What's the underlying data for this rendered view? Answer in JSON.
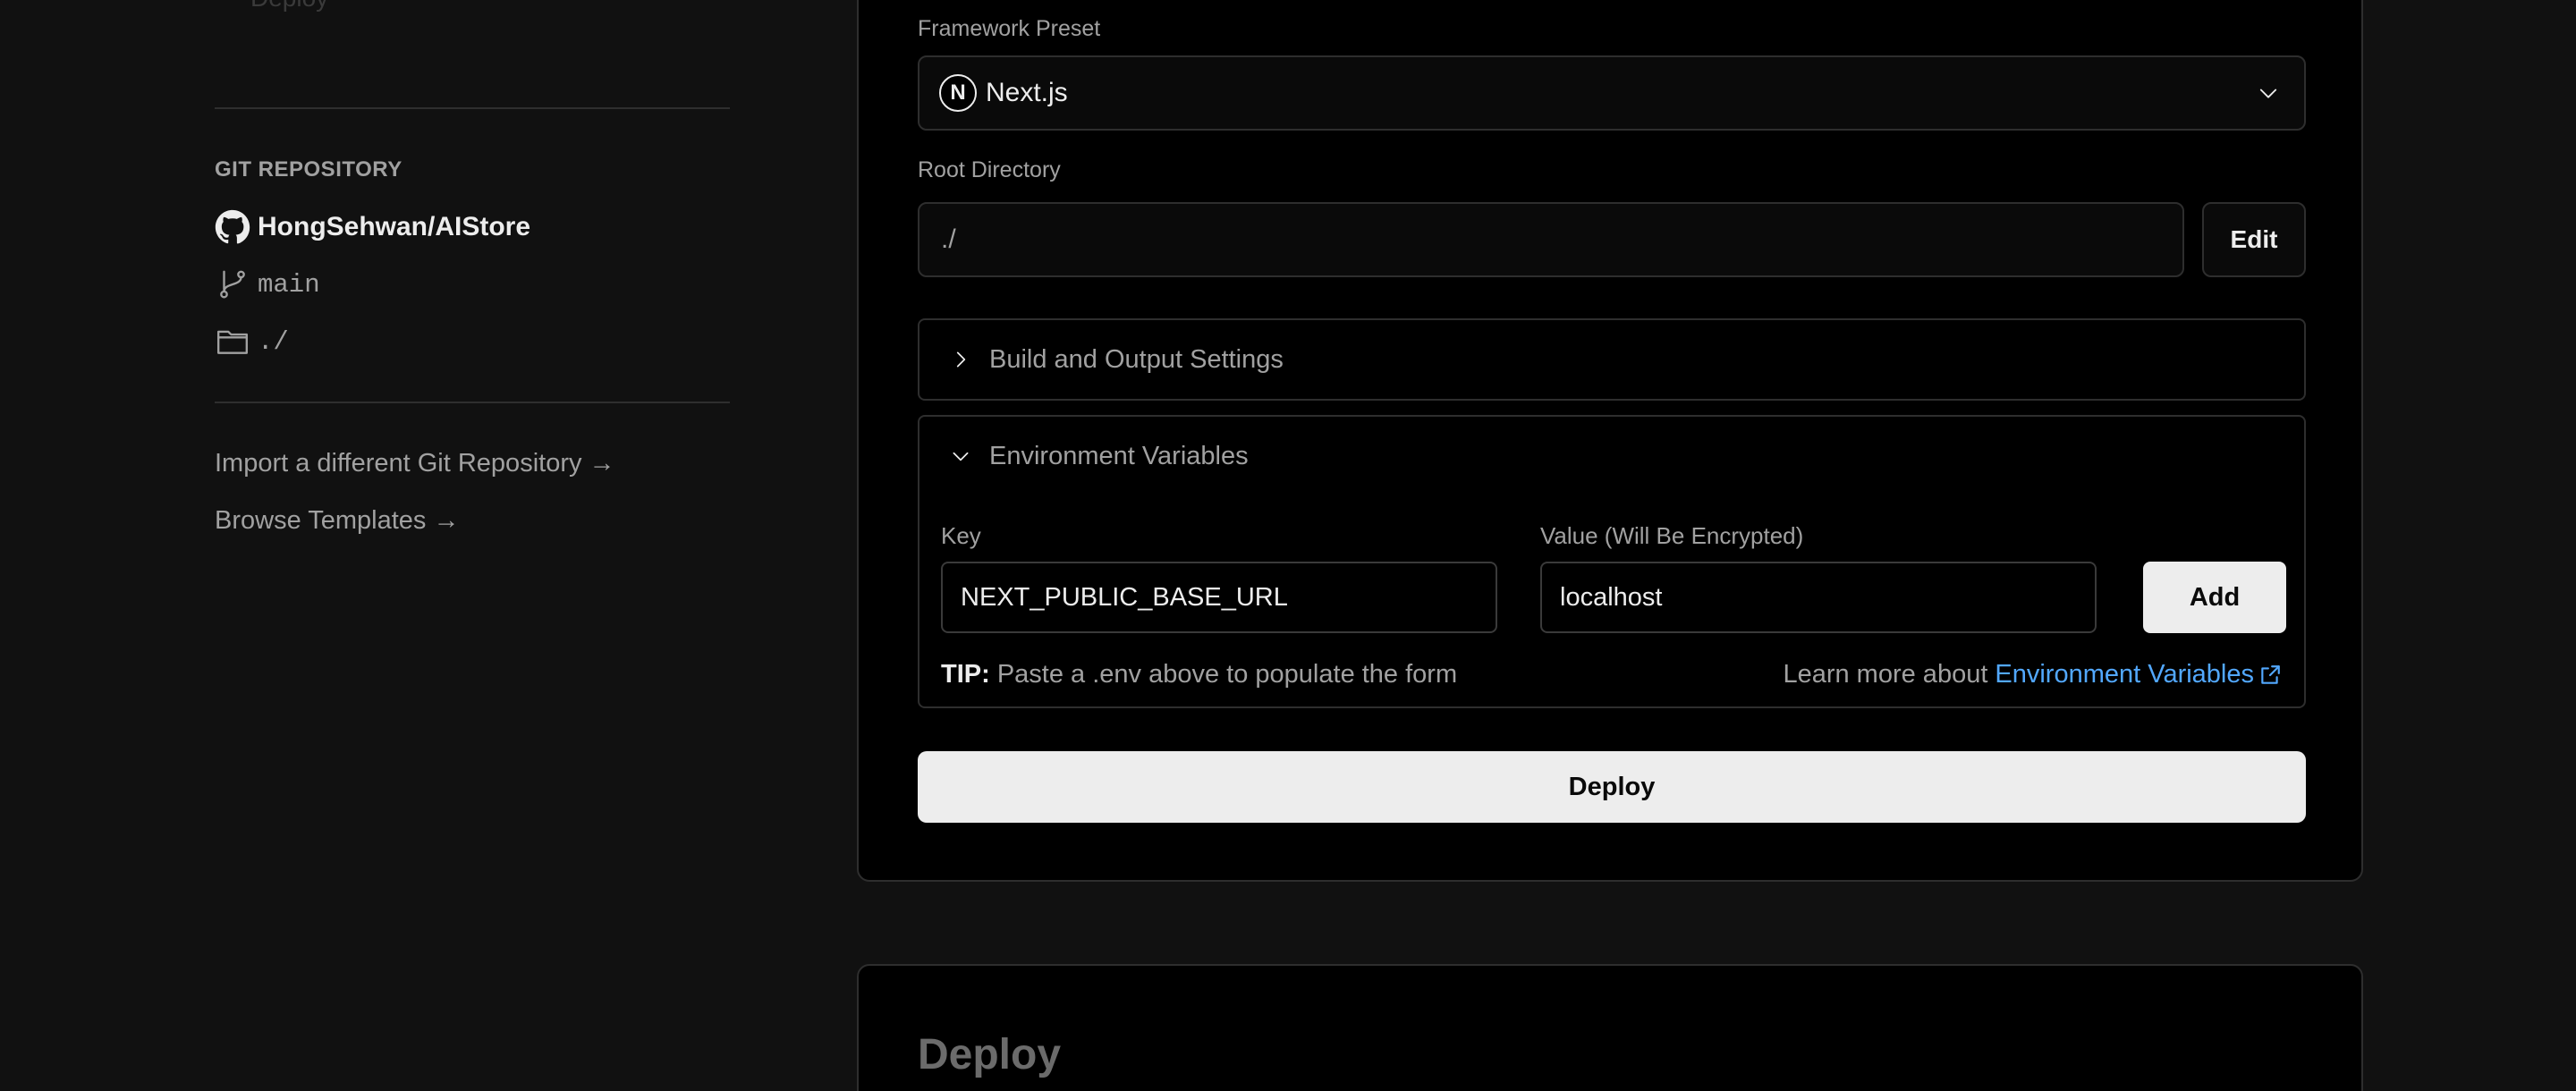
{
  "sidebar": {
    "top_faded_item": "Deploy",
    "git_section_heading": "GIT REPOSITORY",
    "repo_name": "HongSehwan/AIStore",
    "branch": "main",
    "directory": "./",
    "links": [
      {
        "label": "Import a different Git Repository →"
      },
      {
        "label": "Browse Templates →"
      }
    ]
  },
  "config": {
    "framework_label": "Framework Preset",
    "framework_value": "Next.js",
    "framework_logo_letter": "N",
    "root_label": "Root Directory",
    "root_value": "./",
    "edit_label": "Edit",
    "build_settings_title": "Build and Output Settings",
    "env_title": "Environment Variables",
    "env": {
      "key_label": "Key",
      "value_label": "Value (Will Be Encrypted)",
      "key_value": "NEXT_PUBLIC_BASE_URL",
      "value_value": "localhost",
      "add_label": "Add",
      "tip_prefix": "TIP:",
      "tip_text": " Paste a .env above to populate the form",
      "learn_more_text": "Learn more about",
      "learn_more_link": "Environment Variables"
    },
    "deploy_label": "Deploy"
  },
  "deploy_section": {
    "title": "Deploy"
  },
  "colors": {
    "background": "#111111",
    "card": "#000000",
    "accent_link": "#52a8ff",
    "primary_button": "#ededed"
  }
}
